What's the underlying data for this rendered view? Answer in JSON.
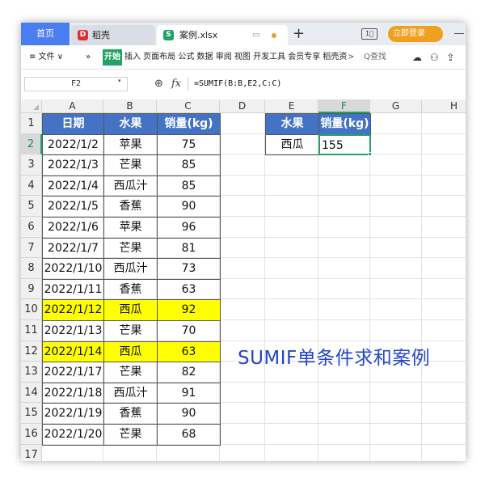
{
  "titlebar": {
    "home_tab": "首页",
    "tabs": [
      {
        "label": "稻壳",
        "badge": "D",
        "badge_color": "#e0312f"
      },
      {
        "label": "案例.xlsx",
        "badge": "S",
        "badge_color": "#21a366"
      }
    ],
    "new_tab": "+",
    "window_icon": "1⃞",
    "login_button": "立即登录"
  },
  "menubar": {
    "file_menu": "≡ 文件 ∨",
    "more": "»",
    "start_tab": "开始",
    "menu_items": "插入 页面布局 公式 数据 审阅 视图 开发工具 会员专享 稻壳资",
    "arrow": ">",
    "search": "Q查找",
    "right_icons": "☁ ⚇ ⇪"
  },
  "formula_bar": {
    "name_box": "F2",
    "fx_label": "fx",
    "formula": "=SUMIF(B:B,E2,C:C)"
  },
  "columns": [
    "A",
    "B",
    "C",
    "D",
    "E",
    "F",
    "G",
    "H"
  ],
  "active_column": "F",
  "rows": [
    "1",
    "2",
    "3",
    "4",
    "5",
    "6",
    "7",
    "8",
    "9",
    "10",
    "11",
    "12",
    "13",
    "14",
    "15",
    "16",
    "17"
  ],
  "active_row": "2",
  "table": {
    "headers": [
      "日期",
      "水果",
      "销量(kg)"
    ],
    "data": [
      {
        "date": "2022/1/2",
        "fruit": "苹果",
        "qty": "75",
        "highlight": false
      },
      {
        "date": "2022/1/3",
        "fruit": "芒果",
        "qty": "85",
        "highlight": false
      },
      {
        "date": "2022/1/4",
        "fruit": "西瓜汁",
        "qty": "85",
        "highlight": false
      },
      {
        "date": "2022/1/5",
        "fruit": "香蕉",
        "qty": "90",
        "highlight": false
      },
      {
        "date": "2022/1/6",
        "fruit": "苹果",
        "qty": "96",
        "highlight": false
      },
      {
        "date": "2022/1/7",
        "fruit": "芒果",
        "qty": "81",
        "highlight": false
      },
      {
        "date": "2022/1/10",
        "fruit": "西瓜汁",
        "qty": "73",
        "highlight": false
      },
      {
        "date": "2022/1/11",
        "fruit": "香蕉",
        "qty": "63",
        "highlight": false
      },
      {
        "date": "2022/1/12",
        "fruit": "西瓜",
        "qty": "92",
        "highlight": true
      },
      {
        "date": "2022/1/13",
        "fruit": "芒果",
        "qty": "70",
        "highlight": false
      },
      {
        "date": "2022/1/14",
        "fruit": "西瓜",
        "qty": "63",
        "highlight": true
      },
      {
        "date": "2022/1/17",
        "fruit": "芒果",
        "qty": "82",
        "highlight": false
      },
      {
        "date": "2022/1/18",
        "fruit": "西瓜汁",
        "qty": "91",
        "highlight": false
      },
      {
        "date": "2022/1/19",
        "fruit": "香蕉",
        "qty": "90",
        "highlight": false
      },
      {
        "date": "2022/1/20",
        "fruit": "芒果",
        "qty": "68",
        "highlight": false
      }
    ]
  },
  "lookup": {
    "headers": [
      "水果",
      "销量(kg)"
    ],
    "criteria": "西瓜",
    "result": "155"
  },
  "annotation": "SUMIF单条件求和案例",
  "colors": {
    "header_fill": "#4472c4",
    "highlight_fill": "#ffff00",
    "selection": "#21a366",
    "annotation_text": "#2446c8"
  }
}
